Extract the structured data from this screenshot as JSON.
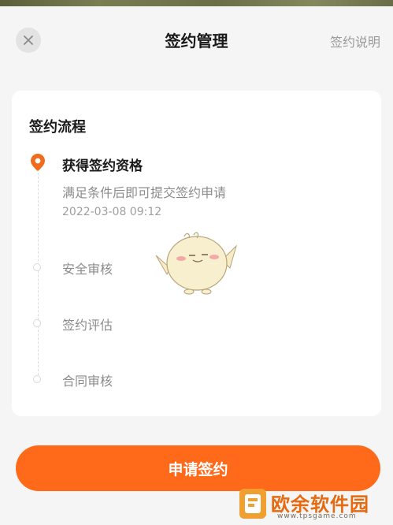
{
  "header": {
    "title": "签约管理",
    "help_link": "签约说明"
  },
  "card": {
    "section_title": "签约流程",
    "steps": [
      {
        "title": "获得签约资格",
        "desc": "满足条件后即可提交签约申请",
        "time": "2022-03-08 09:12",
        "active": true
      },
      {
        "title": "安全审核",
        "active": false
      },
      {
        "title": "签约评估",
        "active": false
      },
      {
        "title": "合同审核",
        "active": false
      }
    ]
  },
  "footer": {
    "apply_label": "申请签约"
  },
  "watermark": {
    "text": "欧余软件园",
    "sub": "www.tpsgame.com"
  },
  "colors": {
    "accent": "#ff6a1a",
    "pin": "#f26a1b",
    "muted_text": "#8c8c8c"
  },
  "icons": {
    "close": "close-icon",
    "pin": "location-pin-icon"
  }
}
